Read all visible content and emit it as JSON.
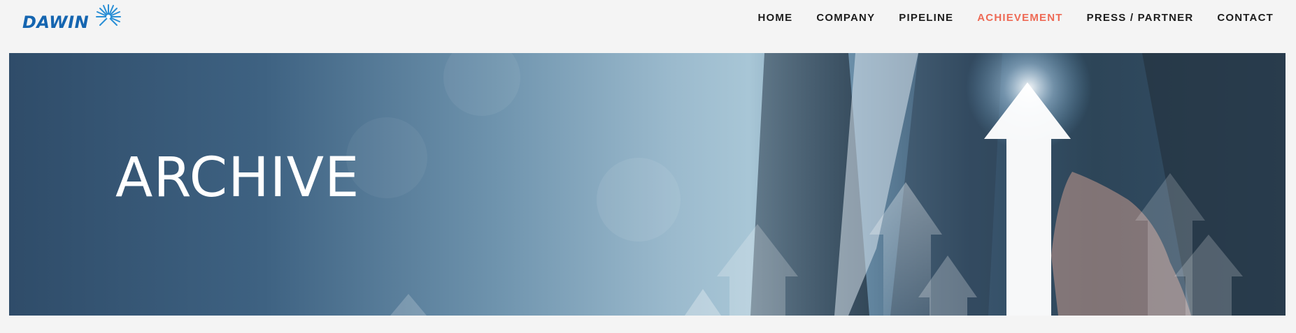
{
  "brand": {
    "name": "DAWIN",
    "primary_color": "#1565b0",
    "accent_color": "#ee6a55"
  },
  "nav": {
    "items": [
      {
        "label": "HOME",
        "active": false
      },
      {
        "label": "COMPANY",
        "active": false
      },
      {
        "label": "PIPELINE",
        "active": false
      },
      {
        "label": "ACHIEVEMENT",
        "active": true
      },
      {
        "label": "PRESS / PARTNER",
        "active": false
      },
      {
        "label": "CONTACT",
        "active": false
      }
    ]
  },
  "hero": {
    "title": "ARCHIVE",
    "image": "business-growth-arrows"
  }
}
